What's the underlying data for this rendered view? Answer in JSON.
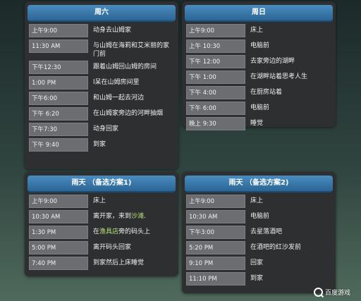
{
  "saturday": {
    "title": "周六",
    "rows": [
      {
        "time": "上午9:00",
        "activity": "动身去山姆家"
      },
      {
        "time": "11:30 AM",
        "activity": "与山姆在海莉和艾米丽的家门前"
      },
      {
        "time": "下午12:30",
        "activity": "跟着山姆回山姆的房间"
      },
      {
        "time": "1:00 PM",
        "activity": "l呆在山姆房间里"
      },
      {
        "time": "下午6:00",
        "activity": "和山姆一起去河边"
      },
      {
        "time": "下午 6:20",
        "activity": "在山姆家旁边的河畔抽烟"
      },
      {
        "time": "下午7:30",
        "activity": "动身回家"
      },
      {
        "time": "下午 9:40",
        "activity": "到家"
      }
    ]
  },
  "sunday": {
    "title": "周日",
    "rows": [
      {
        "time": "上午9:00",
        "activity": "床上"
      },
      {
        "time": "上午 10:30",
        "activity": "电脑前"
      },
      {
        "time": "下午 12:00",
        "activity": "去家旁边的湖畔"
      },
      {
        "time": "下午 1:00",
        "activity": "在湖畔站着思考人生"
      },
      {
        "time": "下午 4:00",
        "activity": "在厨房站着"
      },
      {
        "time": "下午 6:00",
        "activity": "电脑前"
      },
      {
        "time": "晚上 9:30",
        "activity": "睡觉"
      }
    ]
  },
  "rain1": {
    "title": "雨天 （备选方案1)",
    "rows": [
      {
        "time": "上午9:00",
        "activity": "床上"
      },
      {
        "time": "10:30 AM",
        "activity_pre": "离开家，来到",
        "activity_link": "沙滩",
        "activity_post": "."
      },
      {
        "time": "1:30 PM",
        "activity_pre": "在",
        "activity_link": "渔具店",
        "activity_post": "旁的码头上"
      },
      {
        "time": "5:00 PM",
        "activity": "离开码头回家"
      },
      {
        "time": "7:40 PM",
        "activity": "到家然后上床睡觉"
      }
    ]
  },
  "rain2": {
    "title": "雨天 （备选方案2)",
    "rows": [
      {
        "time": "上午9:00",
        "activity": "床上"
      },
      {
        "time": "10:30 AM",
        "activity": "电脑前"
      },
      {
        "time": "下午3:00",
        "activity": "去星落酒吧"
      },
      {
        "time": "5:20 PM",
        "activity": "在酒吧的红沙发前"
      },
      {
        "time": "9:10 PM",
        "activity": "回家"
      },
      {
        "time": "11:10 PM",
        "activity": "到家"
      }
    ]
  },
  "watermark": {
    "text": "百度游戏",
    "icon": "baidu-paw-icon"
  },
  "colors": {
    "header": "#3a7bb0",
    "time_cell": "#6b6d70",
    "link": "#b7e07a",
    "panel": "#2d2f31"
  }
}
